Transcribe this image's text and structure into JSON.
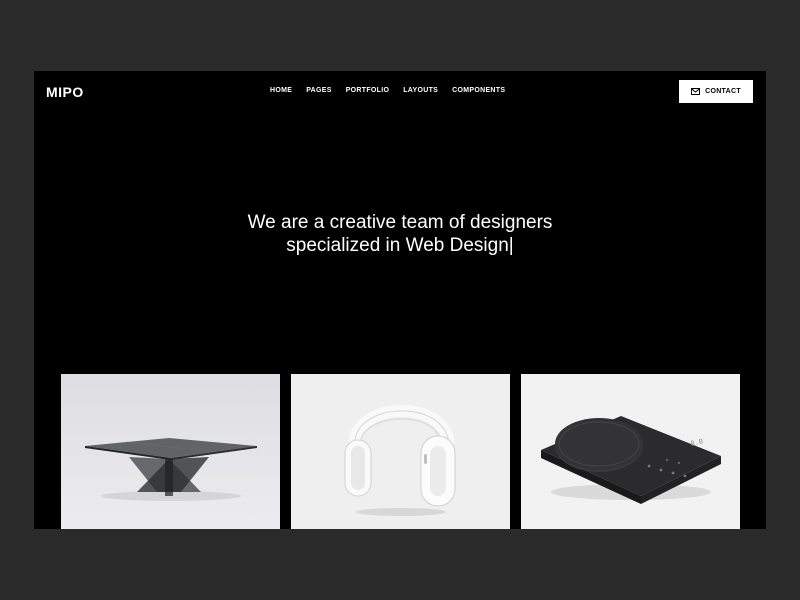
{
  "brand": {
    "logo": "MIPO"
  },
  "nav": {
    "items": [
      {
        "label": "HOME"
      },
      {
        "label": "PAGES"
      },
      {
        "label": "PORTFOLIO"
      },
      {
        "label": "LAYOUTS"
      },
      {
        "label": "COMPONENTS"
      }
    ]
  },
  "header": {
    "contact_label": "CONTACT",
    "contact_icon": "envelope-icon"
  },
  "hero": {
    "line1": "We are a creative team of designers",
    "line2": "specialized in Web Design|"
  },
  "portfolio": {
    "items": [
      {
        "icon": "glass-coffee-table-image",
        "background": "#e6e6e9"
      },
      {
        "icon": "white-headphones-image",
        "background": "#efefef"
      },
      {
        "icon": "black-kitchen-scale-image",
        "background": "#f2f2f2"
      }
    ]
  },
  "colors": {
    "page_background": "#2a2a2a",
    "frame_background": "#000000",
    "text": "#ffffff"
  }
}
